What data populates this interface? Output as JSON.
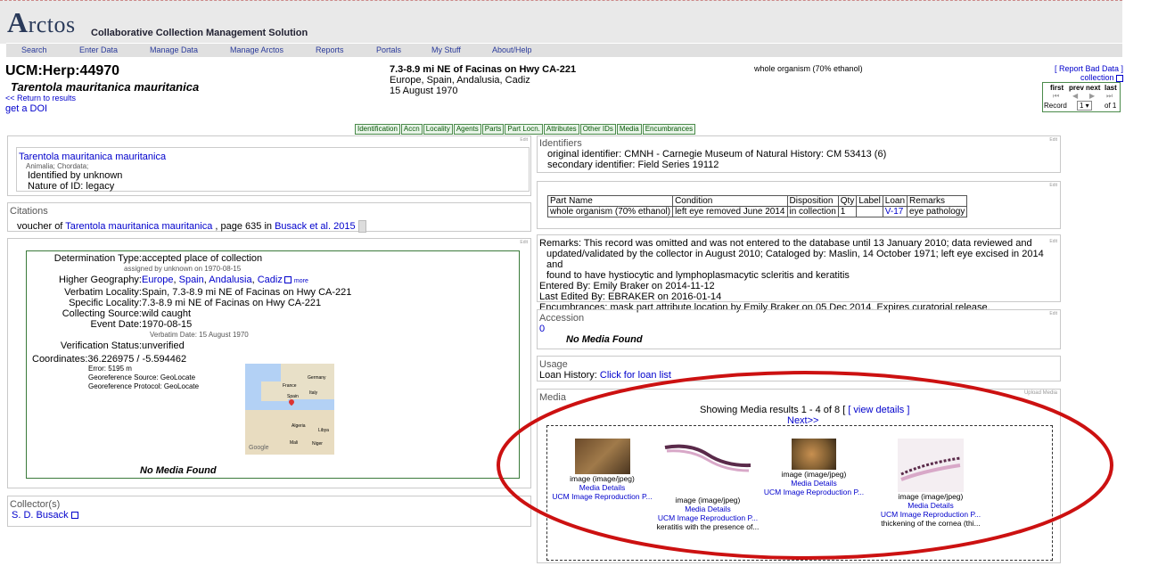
{
  "header": {
    "logo_text": "Arctos",
    "tagline": "Collaborative Collection Management Solution",
    "nav": [
      "Search",
      "Enter Data",
      "Manage Data",
      "Manage Arctos",
      "Reports",
      "Portals",
      "My Stuff",
      "About/Help"
    ]
  },
  "record": {
    "guid": "UCM:Herp:44970",
    "scientific_name": "Tarentola mauritanica mauritanica",
    "return_link": "<< Return to results",
    "doi_link": "get a DOI",
    "locality_title": "7.3-8.9 mi NE of Facinas on Hwy CA-221",
    "locality_geo": "Europe, Spain, Andalusia, Cadiz",
    "date": "15 August 1970",
    "parts_summary": "whole organism (70% ethanol)",
    "report_bad": "[ Report Bad Data ]",
    "collection_link": "collection"
  },
  "pager": {
    "first": "first",
    "prev": "prev",
    "next": "next",
    "last": "last",
    "record_label": "Record",
    "record_value": "1",
    "of": "of 1"
  },
  "tabs": [
    "Identification",
    "Accn",
    "Locality",
    "Agents",
    "Parts",
    "Part Locn.",
    "Attributes",
    "Other IDs",
    "Media",
    "Encumbrances"
  ],
  "edit_label": "Edit",
  "identification": {
    "name": "Tarentola mauritanica mauritanica",
    "taxonomy": "Animalia; Chordata;",
    "identified_by": "Identified by unknown",
    "nature": "Nature of ID: legacy"
  },
  "citations": {
    "heading": "Citations",
    "prefix": "voucher of",
    "taxon": "Tarentola mauritanica mauritanica",
    "page": ", page 635 in",
    "ref": "Busack et al. 2015"
  },
  "locality": {
    "det_type_label": "Determination Type:",
    "det_type": "accepted place of collection",
    "assigned": "assigned by unknown on 1970-08-15",
    "higher_geo_label": "Higher Geography:",
    "higher_geo": [
      "Europe",
      "Spain",
      "Andalusia",
      "Cadiz"
    ],
    "more": "more",
    "verbatim_label": "Verbatim Locality:",
    "verbatim": "Spain, 7.3-8.9 mi NE of Facinas on Hwy CA-221",
    "specific_label": "Specific Locality:",
    "specific": "7.3-8.9 mi NE of Facinas on Hwy CA-221",
    "coll_source_label": "Collecting Source:",
    "coll_source": "wild caught",
    "event_label": "Event Date:",
    "event": "1970-08-15",
    "verbatim_date": "Verbatim Date: 15 August 1970",
    "verification_label": "Verification Status:",
    "verification": "unverified",
    "coords_label": "Coordinates:",
    "coords": "36.226975 / -5.594462",
    "error": "Error: 5195 m",
    "georef_source": "Georeference Source: GeoLocate",
    "georef_protocol": "Georeference Protocol: GeoLocate",
    "no_media": "No Media Found",
    "map_labels": [
      "Germany",
      "France",
      "Italy",
      "Spain",
      "Algeria",
      "Libya",
      "Mali",
      "Niger",
      "Google"
    ]
  },
  "collectors": {
    "heading": "Collector(s)",
    "name": "S. D. Busack"
  },
  "identifiers": {
    "heading": "Identifiers",
    "items": [
      "original identifier: CMNH - Carnegie Museum of Natural History: CM 53413 (6)",
      "secondary identifier: Field Series 19112"
    ]
  },
  "parts_table": {
    "headers": [
      "Part Name",
      "Condition",
      "Disposition",
      "Qty",
      "Label",
      "Loan",
      "Remarks"
    ],
    "rows": [
      [
        "whole organism (70% ethanol)",
        "left eye removed June 2014",
        "in collection",
        "1",
        "",
        "V-17",
        "eye pathology"
      ]
    ]
  },
  "remarks": {
    "text1": "Remarks: This record was omitted and was not entered to the database until 13 January 2010; data reviewed and",
    "text2": "updated/validated by the collector in August 2010; Cataloged by: Maslin, 14 October 1971; left eye excised in 2014 and",
    "text3": "found to have hystiocytic and lymphoplasmacytic scleritis and keratitis",
    "entered": "Entered By: Emily Braker on 2014-11-12",
    "edited": "Last Edited By: EBRAKER on 2016-01-14",
    "encumbrances": "Encumbrances: mask part attribute location by Emily Braker on 05 Dec 2014. Expires curatorial release."
  },
  "accession": {
    "heading": "Accession",
    "value": "0",
    "no_media": "No Media Found"
  },
  "usage": {
    "heading": "Usage",
    "label": "Loan History:",
    "link": "Click for loan list"
  },
  "media": {
    "heading": "Media",
    "upload": "Upload Media",
    "showing": "Showing Media results 1 - 4 of 8 [",
    "view_details": "[ view details ]",
    "next": "Next>>",
    "items": [
      {
        "type": "image (image/jpeg)",
        "details": "Media Details",
        "license": "UCM Image Reproduction P...",
        "caption": ""
      },
      {
        "type": "image (image/jpeg)",
        "details": "Media Details",
        "license": "UCM Image Reproduction P...",
        "caption": "keratitis with the presence of..."
      },
      {
        "type": "image (image/jpeg)",
        "details": "Media Details",
        "license": "UCM Image Reproduction P...",
        "caption": ""
      },
      {
        "type": "image (image/jpeg)",
        "details": "Media Details",
        "license": "UCM Image Reproduction P...",
        "caption": "thickening of the cornea (thi..."
      }
    ]
  },
  "colors": {
    "annotation_ellipse": "#cc1111",
    "tab_border": "#4a8a4a",
    "link": "#0000cc"
  }
}
